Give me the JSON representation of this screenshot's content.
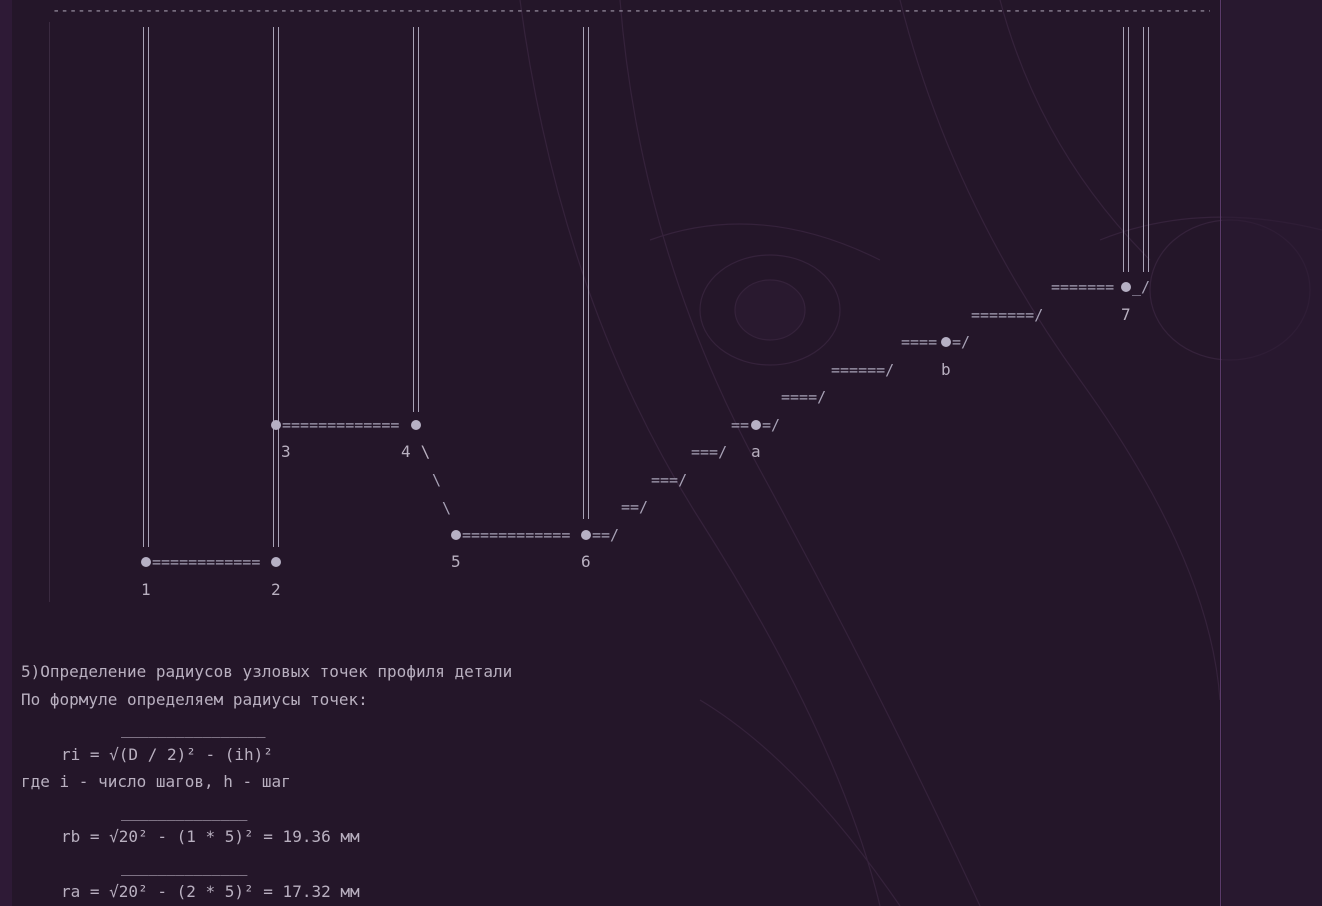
{
  "top_rule": "------------------------------------------------------------------------------------------------------------------------------------------------------",
  "diagram": {
    "points": [
      {
        "label": "1"
      },
      {
        "label": "2"
      },
      {
        "label": "3"
      },
      {
        "label": "4"
      },
      {
        "label": "5"
      },
      {
        "label": "6"
      },
      {
        "label": "a"
      },
      {
        "label": "b"
      },
      {
        "label": "7"
      }
    ],
    "label_4_suffix": " \\",
    "seg_1_2": "============",
    "seg_3_4": "=============",
    "seg_5_6": "============",
    "slash_6": "==/",
    "diag_45_a": "\\",
    "diag_45_b": "\\",
    "stair": [
      "==/",
      "===/",
      "===/",
      "==",
      "=/",
      "====/",
      "======/",
      "====",
      "=/",
      "=======/",
      "=======",
      "_/"
    ]
  },
  "section": {
    "heading": "5)Определение радиусов узловых точек профиля детали",
    "intro": "По формуле определяем радиусы точек:",
    "formula_overline": "________________",
    "formula": "ri = √(D / 2)² - (ih)²",
    "where": "где i - число шагов, h - шаг",
    "rb_overline": "______________",
    "rb": "rb = √20² - (1 * 5)² = 19.36 мм",
    "ra_overline": "______________",
    "ra": "ra = √20² - (2 * 5)² = 17.32 мм"
  },
  "colors": {
    "background": "#241629",
    "text": "#b9b0c0",
    "lines": "#a8a2b6"
  }
}
